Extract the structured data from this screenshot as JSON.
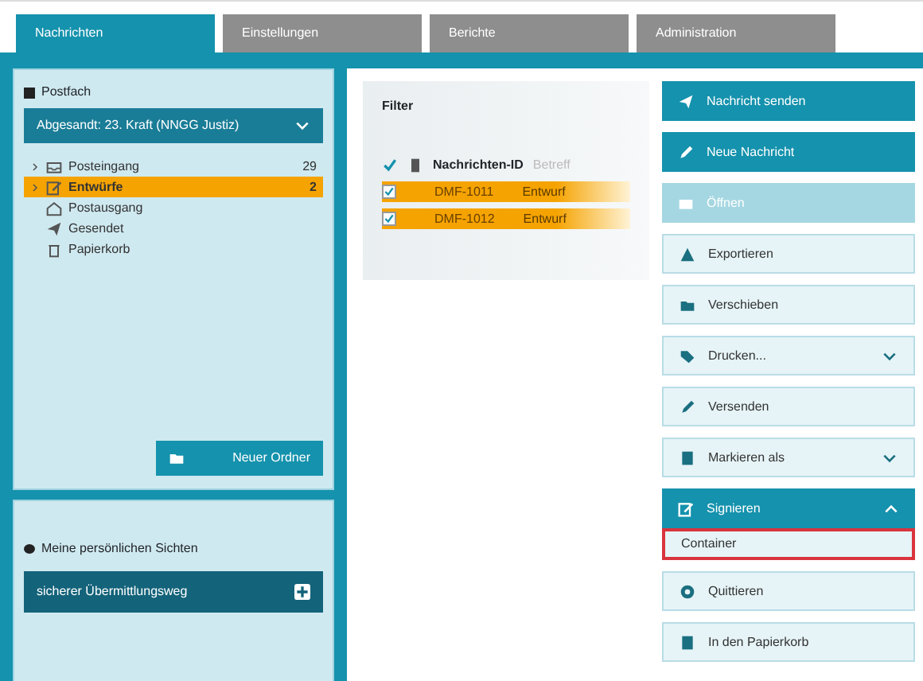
{
  "tabs": [
    {
      "label": "Nachrichten",
      "selected": true
    },
    {
      "label": "Einstellungen",
      "selected": false
    },
    {
      "label": "Berichte",
      "selected": false
    },
    {
      "label": "Administration",
      "selected": false
    }
  ],
  "mailbox": {
    "label": "Postfach",
    "dropdown": "Abgesandt: 23. Kraft (NNGG Justiz)"
  },
  "folders": [
    {
      "label": "Posteingang",
      "count": "29",
      "expandable": true,
      "selected": false
    },
    {
      "label": "Entwürfe",
      "count": "2",
      "expandable": true,
      "selected": true
    },
    {
      "label": "Postausgang",
      "expandable": false,
      "selected": false
    },
    {
      "label": "Gesendet",
      "expandable": false,
      "selected": false
    },
    {
      "label": "Papierkorb",
      "expandable": false,
      "selected": false
    }
  ],
  "new_folder_button": "Neuer Ordner",
  "views": {
    "label": "Meine persönlichen Sichten",
    "dropdown": "sicherer Übermittlungsweg"
  },
  "filter": {
    "title": "Filter",
    "columns": [
      "Nachrichten-ID",
      "Betreff"
    ],
    "rows": [
      {
        "checked": true,
        "cells": [
          "DMF-1011",
          "Entwurf"
        ]
      },
      {
        "checked": true,
        "cells": [
          "DMF-1012",
          "Entwurf"
        ]
      }
    ]
  },
  "actions": [
    {
      "label": "Nachricht senden",
      "kind": "primary"
    },
    {
      "label": "Neue Nachricht",
      "kind": "primary"
    },
    {
      "label": "Öffnen",
      "kind": "disabled"
    },
    {
      "label": "Exportieren",
      "kind": "plain"
    },
    {
      "label": "Verschieben",
      "kind": "plain"
    },
    {
      "label": "Drucken...",
      "kind": "menu"
    },
    {
      "label": "Versenden",
      "kind": "plain"
    },
    {
      "label": "Markieren als",
      "kind": "menu"
    },
    {
      "label": "Signieren",
      "kind": "open"
    },
    {
      "label": "Container",
      "kind": "subitem"
    },
    {
      "label": "Quittieren",
      "kind": "plain"
    },
    {
      "label": "In den Papierkorb",
      "kind": "plain"
    }
  ]
}
